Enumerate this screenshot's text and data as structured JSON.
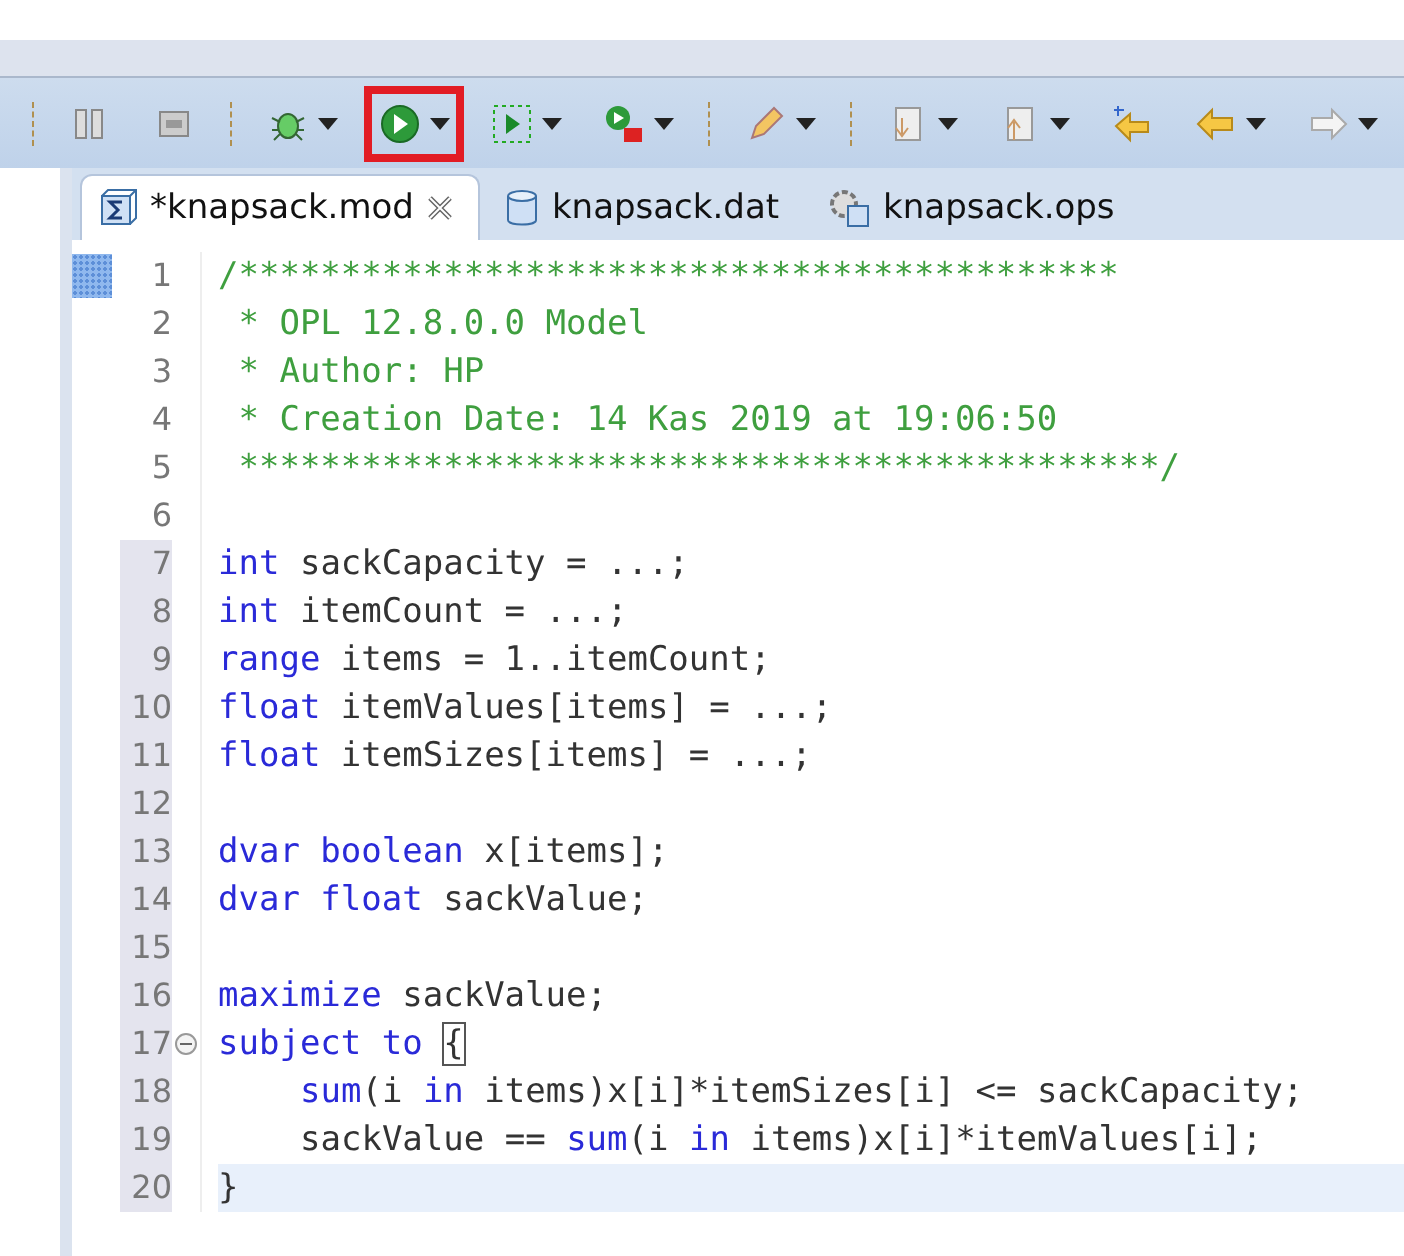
{
  "toolbar": {
    "items": [
      {
        "kind": "separator"
      },
      {
        "kind": "pause",
        "dropdown": false,
        "highlighted": false
      },
      {
        "kind": "stop",
        "dropdown": false,
        "highlighted": false
      },
      {
        "kind": "separator"
      },
      {
        "kind": "debug",
        "dropdown": true,
        "highlighted": false
      },
      {
        "kind": "run",
        "dropdown": true,
        "highlighted": true
      },
      {
        "kind": "runconfig",
        "dropdown": true,
        "highlighted": false
      },
      {
        "kind": "runremote",
        "dropdown": true,
        "highlighted": false
      },
      {
        "kind": "separator"
      },
      {
        "kind": "pen",
        "dropdown": true,
        "highlighted": false
      },
      {
        "kind": "separator"
      },
      {
        "kind": "docdown",
        "dropdown": true,
        "highlighted": false
      },
      {
        "kind": "docup",
        "dropdown": true,
        "highlighted": false
      },
      {
        "kind": "arrowstar",
        "dropdown": false,
        "highlighted": false
      },
      {
        "kind": "arrowleft",
        "dropdown": true,
        "highlighted": false
      },
      {
        "kind": "arrowright",
        "dropdown": true,
        "highlighted": false
      }
    ]
  },
  "tabs": [
    {
      "label": "*knapsack.mod",
      "kind": "model",
      "selected": true
    },
    {
      "label": "knapsack.dat",
      "kind": "data",
      "selected": false
    },
    {
      "label": "knapsack.ops",
      "kind": "settings",
      "selected": false
    }
  ],
  "editor": {
    "lines": [
      {
        "number": "1",
        "changed": false,
        "current": false,
        "marker": true,
        "indented": false,
        "tokens": [
          {
            "kind": "comment",
            "text": "/*******************************************"
          }
        ]
      },
      {
        "number": "2",
        "changed": false,
        "current": false,
        "marker": false,
        "indented": false,
        "tokens": [
          {
            "kind": "comment",
            "text": " * OPL 12.8.0.0 Model"
          }
        ]
      },
      {
        "number": "3",
        "changed": false,
        "current": false,
        "marker": false,
        "indented": false,
        "tokens": [
          {
            "kind": "comment",
            "text": " * Author: HP"
          }
        ]
      },
      {
        "number": "4",
        "changed": false,
        "current": false,
        "marker": false,
        "indented": false,
        "tokens": [
          {
            "kind": "comment",
            "text": " * Creation Date: 14 Kas 2019 at 19:06:50"
          }
        ]
      },
      {
        "number": "5",
        "changed": false,
        "current": false,
        "marker": false,
        "indented": false,
        "tokens": [
          {
            "kind": "comment",
            "text": " *********************************************/"
          }
        ]
      },
      {
        "number": "6",
        "changed": false,
        "current": false,
        "marker": false
      },
      {
        "number": "7",
        "changed": true,
        "current": false,
        "marker": false,
        "indented": false,
        "tokens": [
          {
            "kind": "keyword",
            "text": "int"
          },
          {
            "kind": "plain",
            "text": " sackCapacity = ...;"
          }
        ]
      },
      {
        "number": "8",
        "changed": true,
        "current": false,
        "marker": false,
        "indented": false,
        "tokens": [
          {
            "kind": "keyword",
            "text": "int"
          },
          {
            "kind": "plain",
            "text": " itemCount = ...;"
          }
        ]
      },
      {
        "number": "9",
        "changed": true,
        "current": false,
        "marker": false,
        "indented": false,
        "tokens": [
          {
            "kind": "keyword",
            "text": "range"
          },
          {
            "kind": "plain",
            "text": " items = 1..itemCount;"
          }
        ]
      },
      {
        "number": "10",
        "changed": true,
        "current": false,
        "marker": false,
        "indented": false,
        "tokens": [
          {
            "kind": "keyword",
            "text": "float"
          },
          {
            "kind": "plain",
            "text": " itemValues[items] = ...;"
          }
        ]
      },
      {
        "number": "11",
        "changed": true,
        "current": false,
        "marker": false,
        "indented": false,
        "tokens": [
          {
            "kind": "keyword",
            "text": "float"
          },
          {
            "kind": "plain",
            "text": " itemSizes[items] = ...;"
          }
        ]
      },
      {
        "number": "12",
        "changed": true,
        "current": false,
        "marker": false
      },
      {
        "number": "13",
        "changed": true,
        "current": false,
        "marker": false,
        "indented": false,
        "tokens": [
          {
            "kind": "keyword",
            "text": "dvar boolean"
          },
          {
            "kind": "plain",
            "text": " x[items];"
          }
        ]
      },
      {
        "number": "14",
        "changed": true,
        "current": false,
        "marker": false,
        "indented": false,
        "tokens": [
          {
            "kind": "keyword",
            "text": "dvar float"
          },
          {
            "kind": "plain",
            "text": " sackValue;"
          }
        ]
      },
      {
        "number": "15",
        "changed": true,
        "current": false,
        "marker": false
      },
      {
        "number": "16",
        "changed": true,
        "current": false,
        "marker": false,
        "indented": false,
        "tokens": [
          {
            "kind": "keyword",
            "text": "maximize"
          },
          {
            "kind": "plain",
            "text": " sackValue;"
          }
        ]
      },
      {
        "number": "17",
        "changed": true,
        "current": false,
        "marker": false,
        "indented": false,
        "expanded": true,
        "tokens": [
          {
            "kind": "keyword",
            "text": "subject to "
          },
          {
            "kind": "bracket-match",
            "text": "{"
          }
        ]
      },
      {
        "number": "18",
        "changed": true,
        "current": false,
        "marker": false,
        "indented": true,
        "tokens": [
          {
            "kind": "keyword",
            "text": "sum"
          },
          {
            "kind": "plain",
            "text": "(i "
          },
          {
            "kind": "keyword",
            "text": "in"
          },
          {
            "kind": "plain",
            "text": " items)x[i]*itemSizes[i] <= sackCapacity;"
          }
        ]
      },
      {
        "number": "19",
        "changed": true,
        "current": false,
        "marker": false,
        "indented": true,
        "tokens": [
          {
            "kind": "plain",
            "text": "sackValue == "
          },
          {
            "kind": "keyword",
            "text": "sum"
          },
          {
            "kind": "plain",
            "text": "(i "
          },
          {
            "kind": "keyword",
            "text": "in"
          },
          {
            "kind": "plain",
            "text": " items)x[i]*itemValues[i];"
          }
        ]
      },
      {
        "number": "20",
        "changed": true,
        "current": true,
        "marker": false,
        "indented": false,
        "tokens": [
          {
            "kind": "plain",
            "text": "}"
          }
        ]
      }
    ]
  }
}
